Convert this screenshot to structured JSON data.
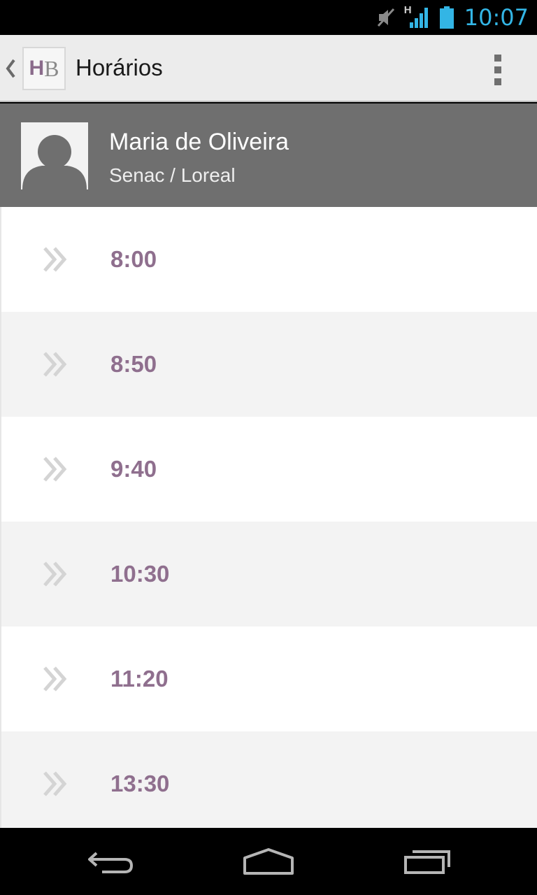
{
  "status_bar": {
    "time": "10:07",
    "network_label": "H",
    "accent_color": "#33b5e5",
    "icons": [
      "mute-icon",
      "signal-icon",
      "battery-icon"
    ]
  },
  "action_bar": {
    "title": "Horários",
    "logo_h": "H",
    "logo_b": "B",
    "icons": [
      "up-chevron-icon",
      "overflow-menu-icon"
    ]
  },
  "profile": {
    "name": "Maria de Oliveira",
    "subtitle": "Senac / Loreal"
  },
  "schedule": {
    "row_icon": "double-chevron-right-icon",
    "time_color": "#8f6f8e",
    "times": [
      "8:00",
      "8:50",
      "9:40",
      "10:30",
      "11:20",
      "13:30"
    ]
  },
  "nav_bar": {
    "buttons": [
      "back-icon",
      "home-icon",
      "recent-apps-icon"
    ]
  }
}
